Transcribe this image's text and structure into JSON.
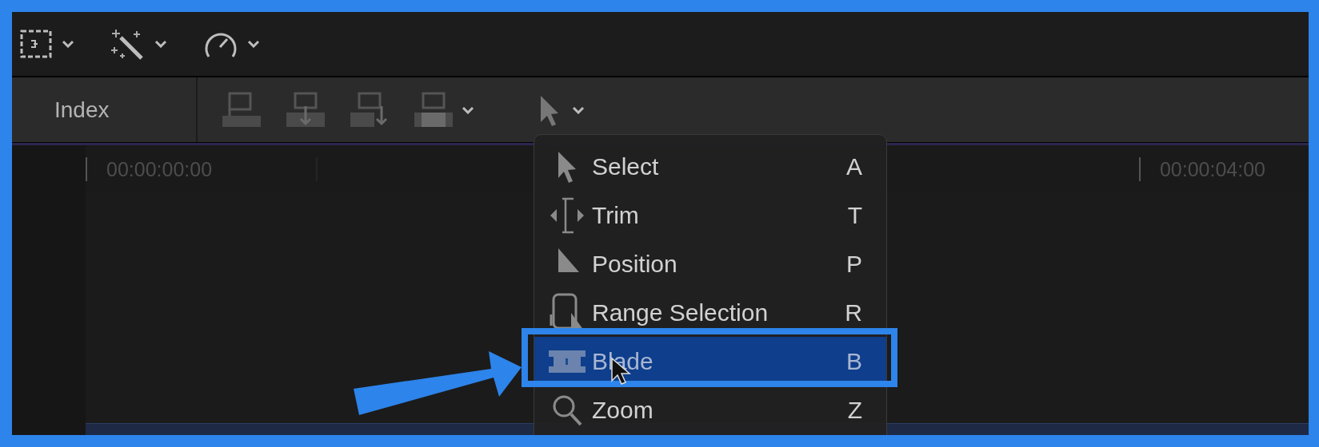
{
  "index_tab": {
    "label": "Index"
  },
  "ruler": {
    "timecodes": [
      "00:00:00:00",
      "00:00:04:00"
    ]
  },
  "tool_menu": {
    "items": [
      {
        "label": "Select",
        "shortcut": "A",
        "selected": false
      },
      {
        "label": "Trim",
        "shortcut": "T",
        "selected": false
      },
      {
        "label": "Position",
        "shortcut": "P",
        "selected": false
      },
      {
        "label": "Range Selection",
        "shortcut": "R",
        "selected": false
      },
      {
        "label": "Blade",
        "shortcut": "B",
        "selected": true
      },
      {
        "label": "Zoom",
        "shortcut": "Z",
        "selected": false
      }
    ]
  }
}
